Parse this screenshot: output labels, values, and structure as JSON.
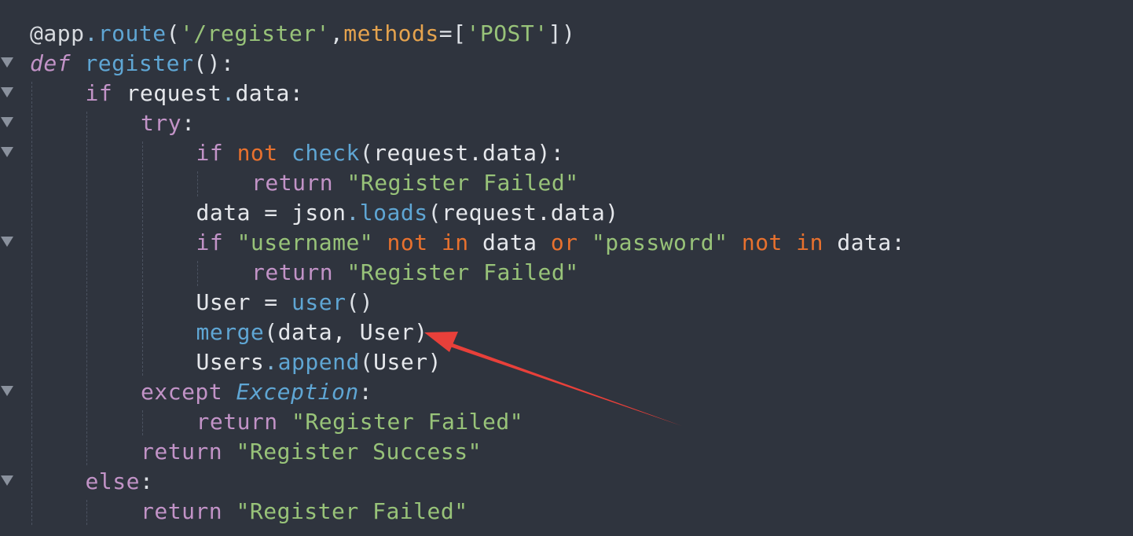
{
  "editor": {
    "language": "python",
    "colors": {
      "background": "#2f343e",
      "keyword": "#c293c7",
      "function": "#5fa6d4",
      "string": "#98c379",
      "operator": "#e8712e",
      "param": "#e5a34e",
      "text": "#e6e8ec",
      "annotation_arrow": "#e8403a"
    },
    "lines": [
      {
        "fold": false,
        "indent": 0,
        "tokens": [
          [
            "dec",
            "@app"
          ],
          [
            "dot",
            "."
          ],
          [
            "mth",
            "route"
          ],
          [
            "pun",
            "("
          ],
          [
            "str",
            "'/register'"
          ],
          [
            "pun",
            ","
          ],
          [
            "par",
            "methods"
          ],
          [
            "pun",
            "=["
          ],
          [
            "str",
            "'POST'"
          ],
          [
            "pun",
            "])"
          ]
        ]
      },
      {
        "fold": true,
        "indent": 0,
        "tokens": [
          [
            "kwi",
            "def"
          ],
          [
            "txt",
            " "
          ],
          [
            "fn",
            "register"
          ],
          [
            "pun",
            "():"
          ]
        ]
      },
      {
        "fold": true,
        "indent": 1,
        "tokens": [
          [
            "kw",
            "if"
          ],
          [
            "txt",
            " request"
          ],
          [
            "dot",
            "."
          ],
          [
            "txt",
            "data:"
          ]
        ]
      },
      {
        "fold": true,
        "indent": 2,
        "tokens": [
          [
            "kw",
            "try"
          ],
          [
            "pun",
            ":"
          ]
        ]
      },
      {
        "fold": true,
        "indent": 3,
        "tokens": [
          [
            "kw",
            "if"
          ],
          [
            "txt",
            " "
          ],
          [
            "op",
            "not"
          ],
          [
            "txt",
            " "
          ],
          [
            "fn",
            "check"
          ],
          [
            "pun",
            "("
          ],
          [
            "txt",
            "request.data):"
          ]
        ]
      },
      {
        "fold": false,
        "indent": 4,
        "tokens": [
          [
            "kw",
            "return"
          ],
          [
            "txt",
            " "
          ],
          [
            "str",
            "\"Register Failed\""
          ]
        ]
      },
      {
        "fold": false,
        "indent": 3,
        "tokens": [
          [
            "txt",
            "data = json"
          ],
          [
            "dot",
            "."
          ],
          [
            "mth",
            "loads"
          ],
          [
            "pun",
            "("
          ],
          [
            "txt",
            "request.data)"
          ]
        ]
      },
      {
        "fold": true,
        "indent": 3,
        "tokens": [
          [
            "kw",
            "if"
          ],
          [
            "txt",
            " "
          ],
          [
            "str",
            "\"username\""
          ],
          [
            "txt",
            " "
          ],
          [
            "op",
            "not in"
          ],
          [
            "txt",
            " data "
          ],
          [
            "op",
            "or"
          ],
          [
            "txt",
            " "
          ],
          [
            "str",
            "\"password\""
          ],
          [
            "txt",
            " "
          ],
          [
            "op",
            "not in"
          ],
          [
            "txt",
            " data:"
          ]
        ]
      },
      {
        "fold": false,
        "indent": 4,
        "tokens": [
          [
            "kw",
            "return"
          ],
          [
            "txt",
            " "
          ],
          [
            "str",
            "\"Register Failed\""
          ]
        ]
      },
      {
        "fold": false,
        "indent": 3,
        "tokens": [
          [
            "txt",
            "User = "
          ],
          [
            "fn",
            "user"
          ],
          [
            "pun",
            "()"
          ]
        ]
      },
      {
        "fold": false,
        "indent": 3,
        "tokens": [
          [
            "fn",
            "merge"
          ],
          [
            "pun",
            "("
          ],
          [
            "txt",
            "data, User)"
          ]
        ]
      },
      {
        "fold": false,
        "indent": 3,
        "tokens": [
          [
            "txt",
            "Users"
          ],
          [
            "dot",
            "."
          ],
          [
            "mth",
            "append"
          ],
          [
            "pun",
            "("
          ],
          [
            "txt",
            "User)"
          ]
        ]
      },
      {
        "fold": true,
        "indent": 2,
        "tokens": [
          [
            "kw",
            "except"
          ],
          [
            "txt",
            " "
          ],
          [
            "cls",
            "Exception"
          ],
          [
            "pun",
            ":"
          ]
        ]
      },
      {
        "fold": false,
        "indent": 3,
        "tokens": [
          [
            "kw",
            "return"
          ],
          [
            "txt",
            " "
          ],
          [
            "str",
            "\"Register Failed\""
          ]
        ]
      },
      {
        "fold": false,
        "indent": 2,
        "tokens": [
          [
            "kw",
            "return"
          ],
          [
            "txt",
            " "
          ],
          [
            "str",
            "\"Register Success\""
          ]
        ]
      },
      {
        "fold": true,
        "indent": 1,
        "tokens": [
          [
            "kw",
            "else"
          ],
          [
            "pun",
            ":"
          ]
        ]
      },
      {
        "fold": false,
        "indent": 2,
        "tokens": [
          [
            "kw",
            "return"
          ],
          [
            "txt",
            " "
          ],
          [
            "str",
            "\"Register Failed\""
          ]
        ]
      }
    ]
  }
}
